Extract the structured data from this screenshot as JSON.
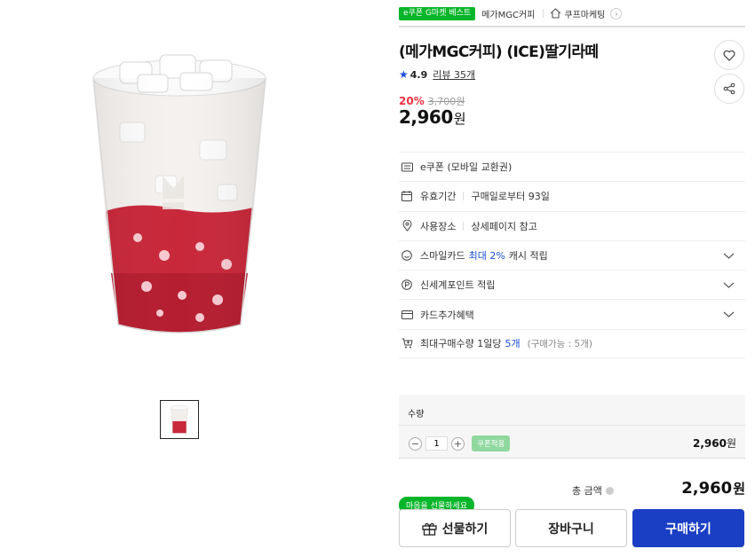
{
  "badges": {
    "ecoupon_best": "e쿠폰 G마켓 베스트",
    "brand": "메가MGC커피",
    "store": "쿠프마케팅",
    "store_go": "›"
  },
  "product": {
    "title": "(메가MGC커피) (ICE)딸기라떼",
    "rating": "4.9",
    "review_text": "리뷰 35개",
    "discount": "20%",
    "original_price": "3,700원",
    "price_number": "2,960",
    "price_unit": "원"
  },
  "info": {
    "type": "e쿠폰 (모바일 교환권)",
    "expiry_label": "유효기간",
    "expiry_value": "구매일로부터 93일",
    "place_label": "사용장소",
    "place_value": "상세페이지 참고",
    "smile_prefix": "스마일카드",
    "smile_highlight": "최대 2%",
    "smile_suffix": "캐시 적립",
    "ssg_point": "신세계포인트 적립",
    "card_benefit": "카드추가혜택",
    "max_purchase_prefix": "최대구매수량 1일당",
    "max_purchase_highlight": "5개",
    "max_purchase_note": "(구매가능 : 5개)"
  },
  "quantity": {
    "label": "수량",
    "minus": "−",
    "plus": "+",
    "value": "1",
    "coupon_chip": "쿠폰적용",
    "line_price_number": "2,960",
    "line_price_unit": "원"
  },
  "total": {
    "label": "총 금액",
    "amount_number": "2,960",
    "amount_unit": "원"
  },
  "actions": {
    "gift_tooltip": "마음을 선물하세요",
    "gift": "선물하기",
    "cart": "장바구니",
    "buy": "구매하기"
  },
  "colors": {
    "brand_green": "#06b529",
    "buy_blue": "#1a3fc4",
    "discount_red": "#f43142",
    "highlight_blue": "#1a4fd6"
  }
}
